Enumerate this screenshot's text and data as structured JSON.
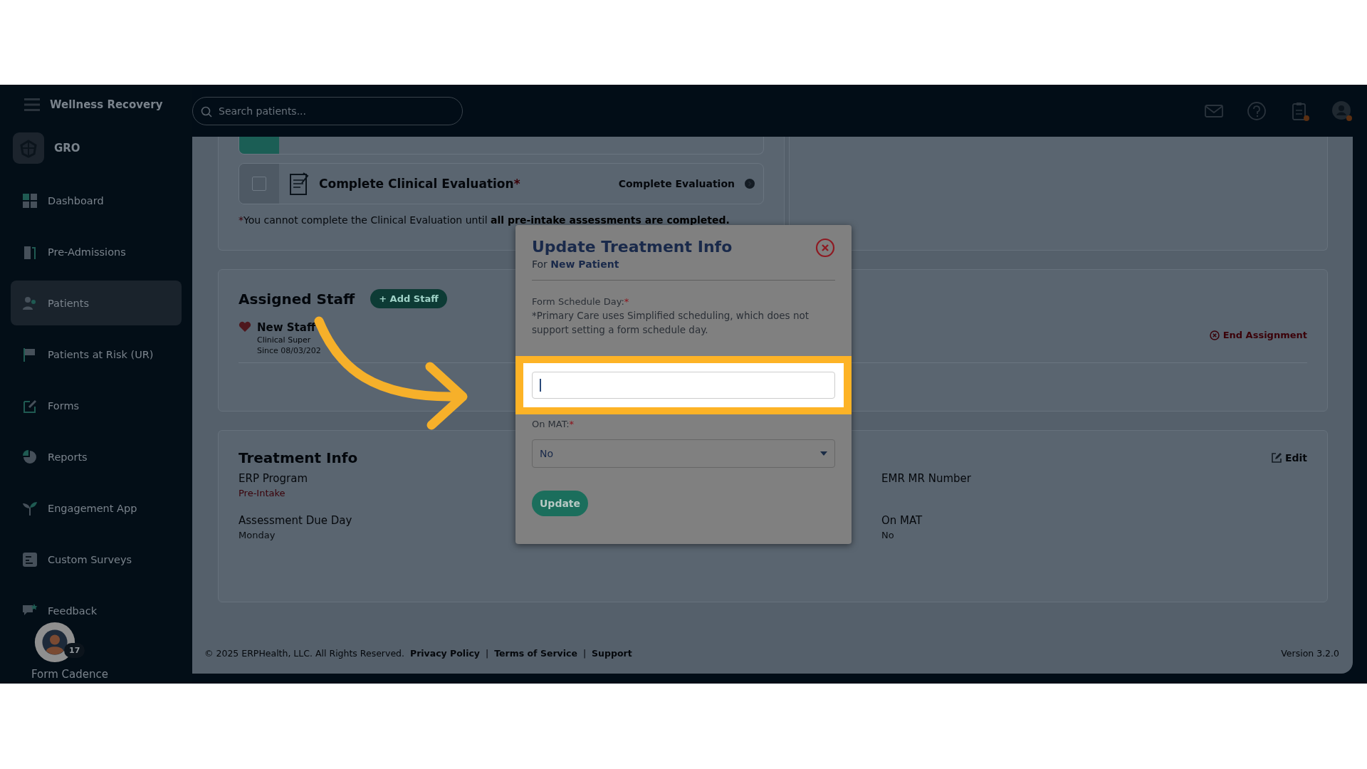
{
  "app": {
    "brand": "Wellness Recovery",
    "org": "GRO"
  },
  "search": {
    "placeholder": "Search patients..."
  },
  "header_icons": [
    {
      "notification": false
    },
    {
      "notification": false
    },
    {
      "notification": true
    },
    {
      "notification": true
    }
  ],
  "sidebar": {
    "items": [
      {
        "label": "Dashboard",
        "selected": false
      },
      {
        "label": "Pre-Admissions",
        "selected": false
      },
      {
        "label": "Patients",
        "selected": true
      },
      {
        "label": "Patients at Risk (UR)",
        "selected": false
      },
      {
        "label": "Forms",
        "selected": false
      },
      {
        "label": "Reports",
        "selected": false
      },
      {
        "label": "Engagement App",
        "selected": false
      },
      {
        "label": "Custom Surveys",
        "selected": false
      },
      {
        "label": "Feedback",
        "selected": false
      }
    ]
  },
  "cadence_widget": {
    "count": "17",
    "label": "Form Cadence"
  },
  "tasks": [
    {
      "label": "Complete Clinical Evaluation",
      "mark": "*",
      "action": "Complete Evaluation",
      "checked": false
    }
  ],
  "task_note": {
    "mark": "*",
    "text": "You cannot complete the Clinical Evaluation until **all pre-intake assessments are completed.**"
  },
  "assigned_staff": {
    "title": "Assigned Staff",
    "add_button": "+ Add Staff",
    "staff": [
      {
        "name": "New Staff",
        "role": "Clinical Super",
        "since": "Since 08/03/202",
        "end_action": "End Assignment"
      }
    ]
  },
  "treatment_info": {
    "title": "Treatment Info",
    "edit": "Edit",
    "columns": [
      [
        {
          "label": "ERP Program",
          "value": "Pre-Intake",
          "alert": true
        },
        {
          "label": "Assessment Due Day",
          "value": "Monday",
          "alert": false
        }
      ],
      [
        {
          "label": "EMR MR Number"
        },
        {
          "label": "On MAT",
          "value": "No",
          "alert": false
        }
      ]
    ]
  },
  "footer": {
    "copyright": "© 2025 ERPHealth, LLC. All Rights Reserved.",
    "separator": "|",
    "links": [
      "Privacy Policy",
      "Terms of Service",
      "Support"
    ],
    "version": "Version 3.2.0"
  },
  "modal": {
    "title": "Update Treatment Info",
    "subtitle_prefix": "For",
    "subtitle_name": "New Patient",
    "schedule_label": "Form Schedule Day:",
    "schedule_mark": "*",
    "schedule_note": "*Primary Care uses Simplified scheduling, which does not support setting a form schedule day.",
    "mat_label": "On MAT:",
    "mat_mark": "*",
    "mat_value": "No",
    "button": "Update"
  }
}
